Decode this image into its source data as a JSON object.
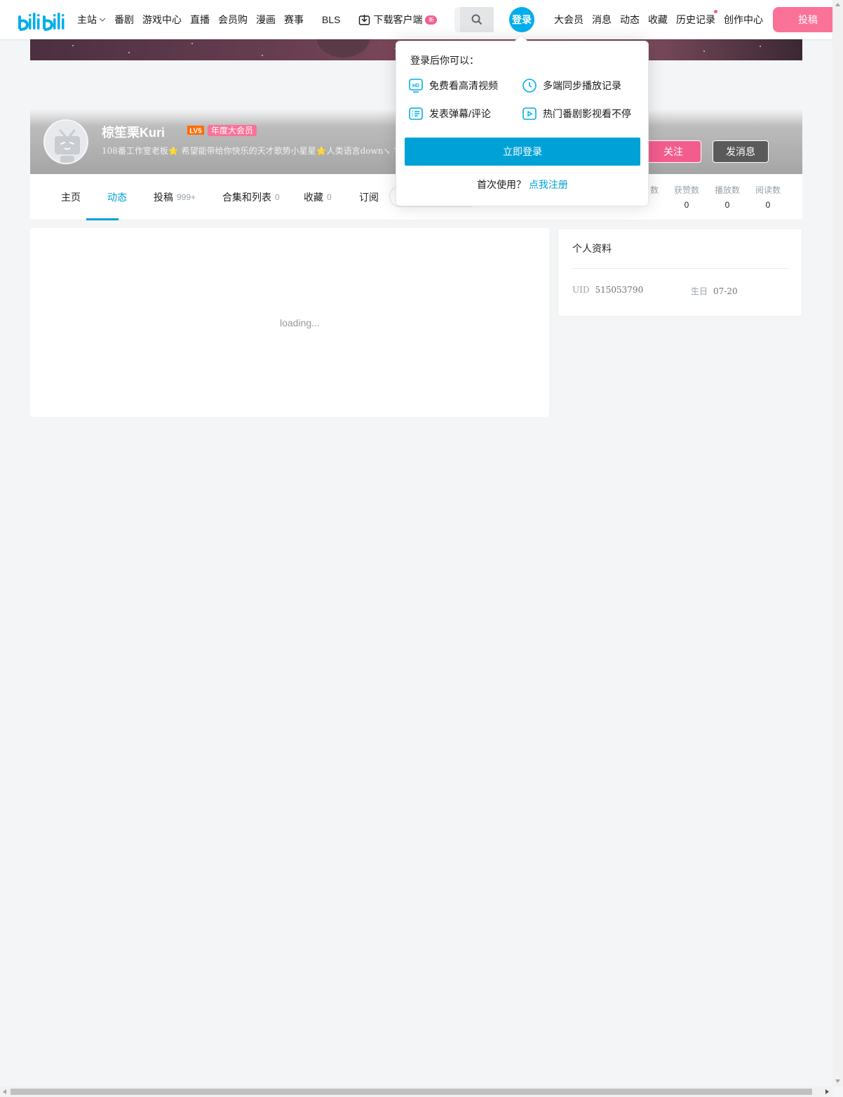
{
  "header": {
    "nav_left": [
      {
        "label": "主站",
        "has_chevron": true
      },
      {
        "label": "番剧"
      },
      {
        "label": "游戏中心"
      },
      {
        "label": "直播"
      },
      {
        "label": "会员购"
      },
      {
        "label": "漫画"
      },
      {
        "label": "赛事"
      }
    ],
    "bls": "BLS",
    "download": {
      "label": "下载客户端",
      "badge": "新"
    },
    "login_avatar_label": "登录",
    "nav_right": [
      "大会员",
      "消息",
      "动态",
      "收藏",
      "历史记录",
      "创作中心"
    ],
    "upload_label": "投稿"
  },
  "profile": {
    "username": "椋笙栗Kuri",
    "level_badge": "LV5",
    "vip_tag": "年度大会员",
    "sign": "108番工作室老板⭐ 希望能带给你快乐的天才歌势小星星⭐人类语言down↘ マ",
    "follow_label": "关注",
    "message_label": "发消息"
  },
  "tabs": [
    {
      "label": "主页",
      "count": ""
    },
    {
      "label": "动态",
      "count": "",
      "active": true
    },
    {
      "label": "投稿",
      "count": "999+"
    },
    {
      "label": "合集和列表",
      "count": "0"
    },
    {
      "label": "收藏",
      "count": "0"
    },
    {
      "label": "订阅",
      "count": ""
    }
  ],
  "stats": [
    {
      "label": "获赞数",
      "value": "0"
    },
    {
      "label": "播放数",
      "value": "0"
    },
    {
      "label": "阅读数",
      "value": "0"
    }
  ],
  "stats_partial_label": "数",
  "main": {
    "loading_text": "loading..."
  },
  "sidebar": {
    "title": "个人资料",
    "uid_label": "UID",
    "uid_value": "515053790",
    "birthday_label": "生日",
    "birthday_value": "07-20"
  },
  "login_popover": {
    "title": "登录后你可以：",
    "benefits": [
      {
        "icon": "hd-icon",
        "label": "免费看高清视频"
      },
      {
        "icon": "clock-icon",
        "label": "多端同步播放记录"
      },
      {
        "icon": "danmaku-icon",
        "label": "发表弹幕/评论"
      },
      {
        "icon": "play-icon",
        "label": "热门番剧影视看不停"
      }
    ],
    "login_button": "立即登录",
    "first_time": "首次使用？",
    "register_link": "点我注册"
  },
  "colors": {
    "brand_blue": "#00a1d6",
    "brand_pink": "#fb7299",
    "follow_pink": "#f25d8e"
  }
}
